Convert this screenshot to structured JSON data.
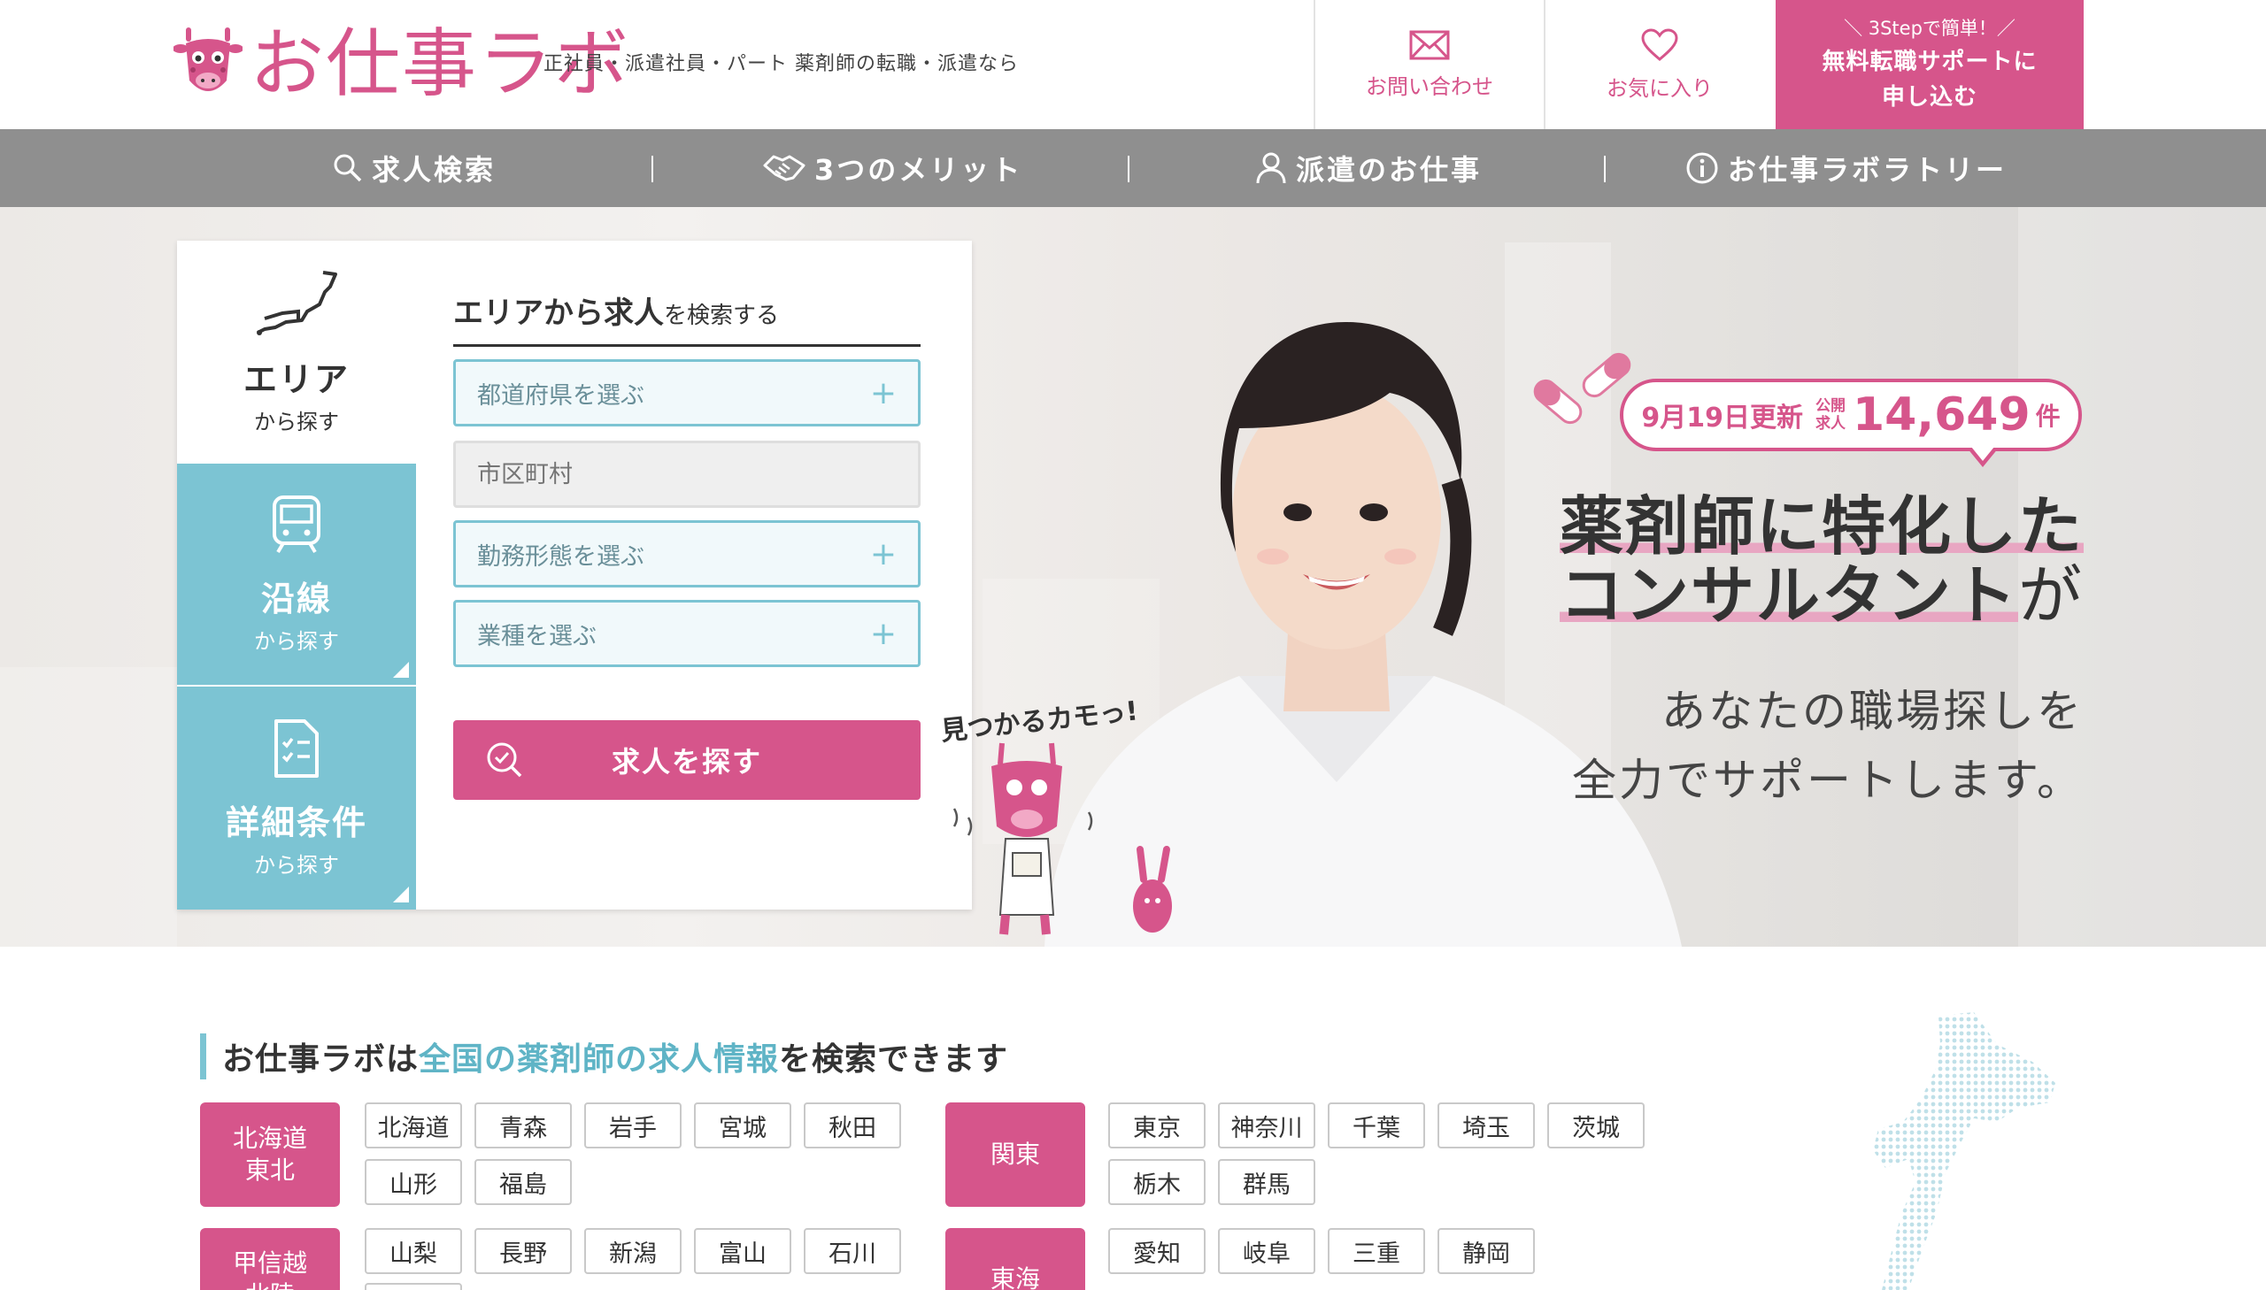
{
  "header": {
    "logo_text": "お仕事ラボ",
    "tagline": "正社員・派遣社員・パート 薬剤師の転職・派遣なら",
    "contact_label": "お問い合わせ",
    "favorites_label": "お気に入り",
    "cta_small": "＼ 3Stepで簡単！／",
    "cta_line1": "無料転職サポートに",
    "cta_line2": "申し込む"
  },
  "nav": {
    "items": [
      {
        "label": "求人検索",
        "icon": "search-icon"
      },
      {
        "label": "3つのメリット",
        "icon": "handshake-icon"
      },
      {
        "label": "派遣のお仕事",
        "icon": "person-icon"
      },
      {
        "label": "お仕事ラボラトリー",
        "icon": "info-icon"
      }
    ]
  },
  "search_panel": {
    "tabs": [
      {
        "title": "エリア",
        "sub": "から探す",
        "icon": "japan-map-icon"
      },
      {
        "title": "沿線",
        "sub": "から探す",
        "icon": "train-icon"
      },
      {
        "title": "詳細条件",
        "sub": "から探す",
        "icon": "document-icon"
      }
    ],
    "heading_bold": "エリアから求人",
    "heading_rest": "を検索する",
    "prefecture_select": "都道府県を選ぶ",
    "city_placeholder": "市区町村",
    "employment_select": "勤務形態を選ぶ",
    "industry_select": "業種を選ぶ",
    "search_button": "求人を探す"
  },
  "hero": {
    "update_date": "9月19日更新",
    "public_label_1": "公開",
    "public_label_2": "求人",
    "job_count": "14,649",
    "count_unit": "件",
    "headline_1": "薬剤師に特化した",
    "headline_2_hl": "コンサルタント",
    "headline_2_rest": "が",
    "sub_1": "あなたの職場探しを",
    "sub_2": "全力でサポートします。",
    "mascot_speech": "見つかるカモっ!"
  },
  "area_section": {
    "title_pre": "お仕事ラボは",
    "title_accent": "全国の薬剤師の求人情報",
    "title_post": "を検索できます",
    "regions": [
      {
        "name_1": "北海道",
        "name_2": "東北",
        "prefs": [
          "北海道",
          "青森",
          "岩手",
          "宮城",
          "秋田",
          "山形",
          "福島"
        ]
      },
      {
        "name_1": "関東",
        "name_2": "",
        "prefs": [
          "東京",
          "神奈川",
          "千葉",
          "埼玉",
          "茨城",
          "栃木",
          "群馬"
        ]
      },
      {
        "name_1": "甲信越",
        "name_2": "北陸",
        "prefs": [
          "山梨",
          "長野",
          "新潟",
          "富山",
          "石川",
          ""
        ]
      },
      {
        "name_1": "東海",
        "name_2": "",
        "prefs": [
          "愛知",
          "岐阜",
          "三重",
          "静岡"
        ]
      }
    ]
  },
  "colors": {
    "brand_pink": "#d6558b",
    "accent_teal": "#7cc4d3",
    "nav_gray": "#8f8f8f"
  }
}
